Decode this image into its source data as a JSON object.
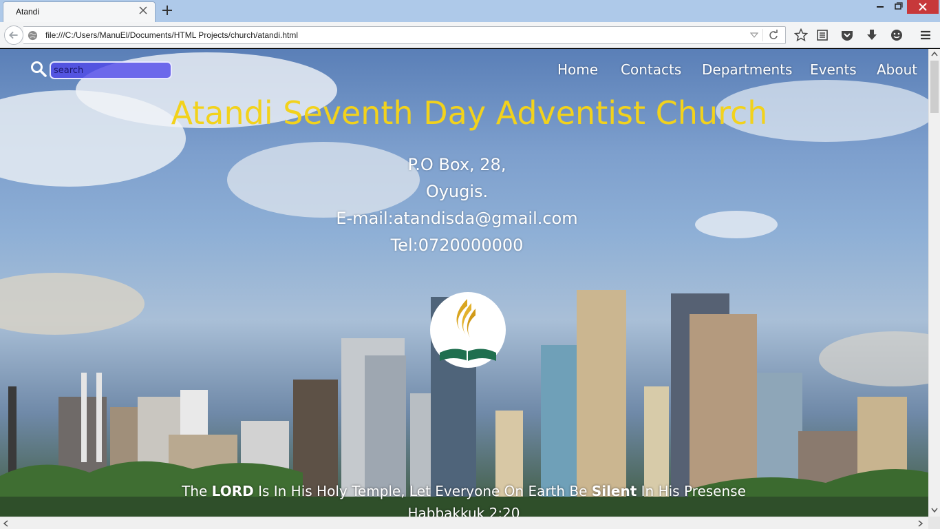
{
  "browser": {
    "tab_title": "Atandi",
    "url": "file:///C:/Users/ManuEl/Documents/HTML Projects/church/atandi.html",
    "toolbar_icons": [
      "star-icon",
      "reading-list-icon",
      "pocket-icon",
      "download-icon",
      "chat-icon",
      "menu-icon"
    ]
  },
  "page": {
    "search": {
      "placeholder": "search",
      "value": ""
    },
    "nav": {
      "home": "Home",
      "contacts": "Contacts",
      "departments": "Departments",
      "events": "Events",
      "about": "About"
    },
    "title": "Atandi Seventh Day Adventist Church",
    "address": {
      "line1": "P.O Box, 28,",
      "line2": "Oyugis.",
      "line3": "E-mail:atandisda@gmail.com",
      "line4": "Tel:0720000000"
    },
    "verse": {
      "part1": "The ",
      "bold1": "LORD",
      "part2": " Is In His Holy Temple, Let Everyone On Earth Be ",
      "bold2": "Silent",
      "part3": " In His Presense",
      "reference": "Habbakkuk 2:20"
    }
  },
  "colors": {
    "title": "#f2d21c",
    "search_fill": "#5046eb",
    "logo_gold": "#d9a520",
    "logo_green": "#1f6f4f"
  }
}
